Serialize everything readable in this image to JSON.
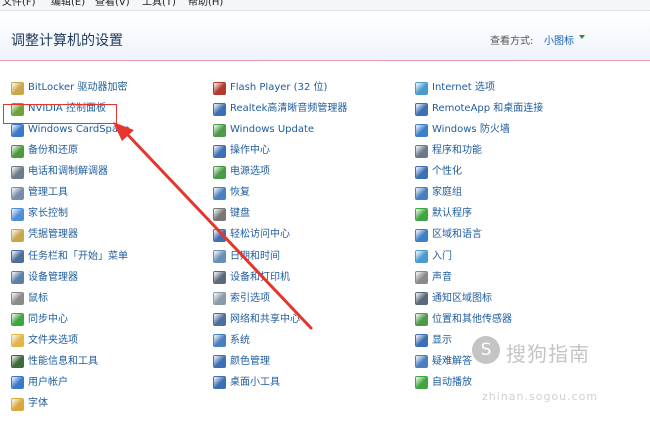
{
  "menu": [
    "文件(F)",
    "编辑(E)",
    "查看(V)",
    "工具(T)",
    "帮助(H)"
  ],
  "header": {
    "title": "调整计算机的设置",
    "view_label": "查看方式:",
    "view_value": "小图标"
  },
  "columns": [
    [
      {
        "label": "BitLocker 驱动器加密",
        "icon": "bitlocker-icon",
        "color": "#c9a64a"
      },
      {
        "label": "NVIDIA 控制面板",
        "icon": "nvidia-icon",
        "color": "#6fa23a"
      },
      {
        "label": "Windows CardSpace",
        "icon": "cardspace-icon",
        "color": "#3b78c8"
      },
      {
        "label": "备份和还原",
        "icon": "backup-icon",
        "color": "#4c9a3f"
      },
      {
        "label": "电话和调制解调器",
        "icon": "phone-modem-icon",
        "color": "#6c7a8a"
      },
      {
        "label": "管理工具",
        "icon": "admin-tools-icon",
        "color": "#7a8ca8"
      },
      {
        "label": "家长控制",
        "icon": "parental-control-icon",
        "color": "#4f8fd6"
      },
      {
        "label": "凭据管理器",
        "icon": "credential-manager-icon",
        "color": "#c9a64a"
      },
      {
        "label": "任务栏和「开始」菜单",
        "icon": "taskbar-icon",
        "color": "#4d6f99"
      },
      {
        "label": "设备管理器",
        "icon": "device-manager-icon",
        "color": "#5a7fa8"
      },
      {
        "label": "鼠标",
        "icon": "mouse-icon",
        "color": "#8a8a8a"
      },
      {
        "label": "同步中心",
        "icon": "sync-center-icon",
        "color": "#3fa53f"
      },
      {
        "label": "文件夹选项",
        "icon": "folder-options-icon",
        "color": "#e1b54a"
      },
      {
        "label": "性能信息和工具",
        "icon": "performance-icon",
        "color": "#3d6a3a"
      },
      {
        "label": "用户帐户",
        "icon": "user-accounts-icon",
        "color": "#3b78c8"
      },
      {
        "label": "字体",
        "icon": "fonts-icon",
        "color": "#d8a83c"
      }
    ],
    [
      {
        "label": "Flash Player (32 位)",
        "icon": "flash-player-icon",
        "color": "#b03a2e"
      },
      {
        "label": "Realtek高清晰音频管理器",
        "icon": "realtek-audio-icon",
        "color": "#3d6fb5"
      },
      {
        "label": "Windows Update",
        "icon": "windows-update-icon",
        "color": "#4a9a4a"
      },
      {
        "label": "操作中心",
        "icon": "action-center-icon",
        "color": "#3d6fb5"
      },
      {
        "label": "电源选项",
        "icon": "power-options-icon",
        "color": "#4a9a4a"
      },
      {
        "label": "恢复",
        "icon": "recovery-icon",
        "color": "#4a7fc0"
      },
      {
        "label": "键盘",
        "icon": "keyboard-icon",
        "color": "#777777"
      },
      {
        "label": "轻松访问中心",
        "icon": "ease-of-access-icon",
        "color": "#3d6fb5"
      },
      {
        "label": "日期和时间",
        "icon": "date-time-icon",
        "color": "#6a8fb5"
      },
      {
        "label": "设备和打印机",
        "icon": "devices-printers-icon",
        "color": "#5a6a7a"
      },
      {
        "label": "索引选项",
        "icon": "indexing-options-icon",
        "color": "#8a9aa8"
      },
      {
        "label": "网络和共享中心",
        "icon": "network-sharing-icon",
        "color": "#4a6fa0"
      },
      {
        "label": "系统",
        "icon": "system-icon",
        "color": "#4a7fc0"
      },
      {
        "label": "颜色管理",
        "icon": "color-management-icon",
        "color": "#3d6fb5"
      },
      {
        "label": "桌面小工具",
        "icon": "gadgets-icon",
        "color": "#3d6fb5"
      }
    ],
    [
      {
        "label": "Internet 选项",
        "icon": "internet-options-icon",
        "color": "#4a9ad0"
      },
      {
        "label": "RemoteApp 和桌面连接",
        "icon": "remoteapp-icon",
        "color": "#3d6fb5"
      },
      {
        "label": "Windows 防火墙",
        "icon": "firewall-icon",
        "color": "#3d7fc8"
      },
      {
        "label": "程序和功能",
        "icon": "programs-features-icon",
        "color": "#6a7a8a"
      },
      {
        "label": "个性化",
        "icon": "personalization-icon",
        "color": "#3d6fb5"
      },
      {
        "label": "家庭组",
        "icon": "homegroup-icon",
        "color": "#4a7fc0"
      },
      {
        "label": "默认程序",
        "icon": "default-programs-icon",
        "color": "#3fa53f"
      },
      {
        "label": "区域和语言",
        "icon": "region-language-icon",
        "color": "#3d7fc8"
      },
      {
        "label": "入门",
        "icon": "getting-started-icon",
        "color": "#4a9ad0"
      },
      {
        "label": "声音",
        "icon": "sound-icon",
        "color": "#8a8a8a"
      },
      {
        "label": "通知区域图标",
        "icon": "notification-area-icon",
        "color": "#5a6a7a"
      },
      {
        "label": "位置和其他传感器",
        "icon": "location-sensors-icon",
        "color": "#4a9a4a"
      },
      {
        "label": "显示",
        "icon": "display-icon",
        "color": "#3d6fb5"
      },
      {
        "label": "疑难解答",
        "icon": "troubleshooting-icon",
        "color": "#4a7fc0"
      },
      {
        "label": "自动播放",
        "icon": "autoplay-icon",
        "color": "#3fa53f"
      }
    ]
  ],
  "watermark": {
    "badge": "S",
    "text": "搜狗指南",
    "url": "zhinan.sogou.com"
  },
  "colors": {
    "link": "#1e5c9b",
    "title": "#1e395b",
    "highlight": "#e5352c"
  }
}
